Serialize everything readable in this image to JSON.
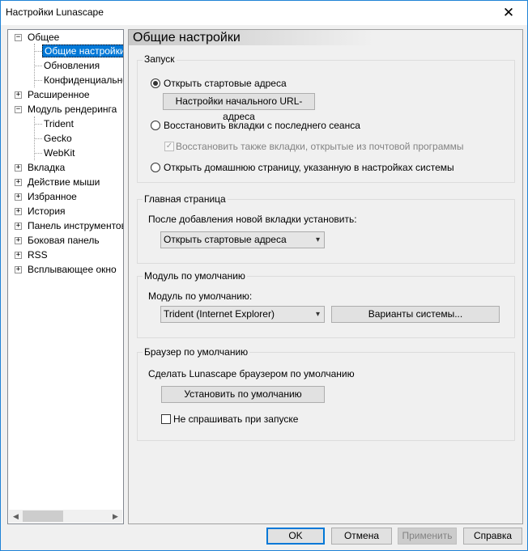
{
  "window": {
    "title": "Настройки Lunascape"
  },
  "tree": {
    "items": [
      {
        "label": "Общее",
        "expander": "−"
      },
      {
        "label": "Общие настройки"
      },
      {
        "label": "Обновления"
      },
      {
        "label": "Конфиденциальность"
      },
      {
        "label": "Расширенное",
        "expander": "+"
      },
      {
        "label": "Модуль рендеринга",
        "expander": "−"
      },
      {
        "label": "Trident"
      },
      {
        "label": "Gecko"
      },
      {
        "label": "WebKit"
      },
      {
        "label": "Вкладка",
        "expander": "+"
      },
      {
        "label": "Действие мыши",
        "expander": "+"
      },
      {
        "label": "Избранное",
        "expander": "+"
      },
      {
        "label": "История",
        "expander": "+"
      },
      {
        "label": "Панель инструментов",
        "expander": "+"
      },
      {
        "label": "Боковая панель",
        "expander": "+"
      },
      {
        "label": "RSS",
        "expander": "+"
      },
      {
        "label": "Всплывающее окно",
        "expander": "+"
      }
    ],
    "selected": "Общие настройки"
  },
  "panel": {
    "title": "Общие настройки"
  },
  "startup": {
    "group_label": "Запуск",
    "opt_start": "Открыть стартовые адреса",
    "start_url_button": "Настройки начального URL-адреса",
    "opt_restore": "Восстановить вкладки с последнего сеанса",
    "restore_mail_check": "Восстановить также вкладки, открытые из почтовой программы",
    "opt_home": "Открыть домашнюю страницу, указанную в настройках системы",
    "selected": "opt_start"
  },
  "homepage": {
    "group_label": "Главная страница",
    "label": "После добавления новой вкладки установить:",
    "combo_value": "Открыть стартовые адреса"
  },
  "module": {
    "group_label": "Модуль по умолчанию",
    "label": "Модуль по умолчанию:",
    "combo_value": "Trident (Internet Explorer)",
    "variants_button": "Варианты системы..."
  },
  "browser": {
    "group_label": "Браузер по умолчанию",
    "label": "Сделать Lunascape браузером по умолчанию",
    "set_default_button": "Установить по умолчанию",
    "dont_ask_check": "Не спрашивать при запуске"
  },
  "buttons": {
    "ok": "OK",
    "cancel": "Отмена",
    "apply": "Применить",
    "help": "Справка"
  },
  "icons": {
    "close": "close-icon",
    "expand": "plus-icon",
    "collapse": "minus-icon",
    "dropdown": "chevron-down-icon",
    "scroll_left": "arrow-left-icon",
    "scroll_right": "arrow-right-icon"
  },
  "colors": {
    "accent": "#0078d7",
    "window_border": "#1f83d6"
  }
}
